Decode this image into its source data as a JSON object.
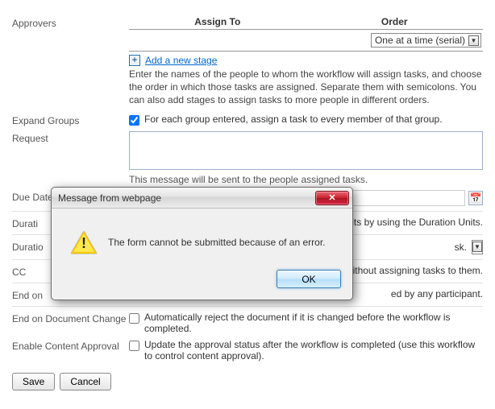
{
  "approvers": {
    "label": "Approvers",
    "table": {
      "assign_to_header": "Assign To",
      "order_header": "Order",
      "order_value": "One at a time (serial)"
    },
    "add_stage_link": "Add a new stage",
    "desc": "Enter the names of the people to whom the workflow will assign tasks, and choose the order in which those tasks are assigned. Separate them with semicolons. You can also add stages to assign tasks to more people in different orders."
  },
  "expand_groups": {
    "label": "Expand Groups",
    "checkbox_checked": true,
    "text": "For each group entered, assign a task to every member of that group."
  },
  "request": {
    "label": "Request",
    "hint": "This message will be sent to the people assigned tasks."
  },
  "due_date": {
    "label": "Due Date for All Tasks"
  },
  "duration_per": {
    "label": "Durati",
    "right_text": "nits by using the Duration Units."
  },
  "duration_units": {
    "label": "Duratio",
    "right_text": "sk."
  },
  "cc": {
    "label": "CC",
    "right_text": "nds without assigning tasks to them."
  },
  "end_on_rejection": {
    "label": "End on",
    "right_text": "ed by any participant."
  },
  "end_on_change": {
    "label": "End on Document Change",
    "text": "Automatically reject the document if it is changed before the workflow is completed."
  },
  "content_approval": {
    "label": "Enable Content Approval",
    "text": "Update the approval status after the workflow is completed (use this workflow to control content approval)."
  },
  "buttons": {
    "save": "Save",
    "cancel": "Cancel"
  },
  "modal": {
    "title": "Message from webpage",
    "message": "The form cannot be submitted because of an error.",
    "ok": "OK",
    "close_symbol": "✕"
  }
}
